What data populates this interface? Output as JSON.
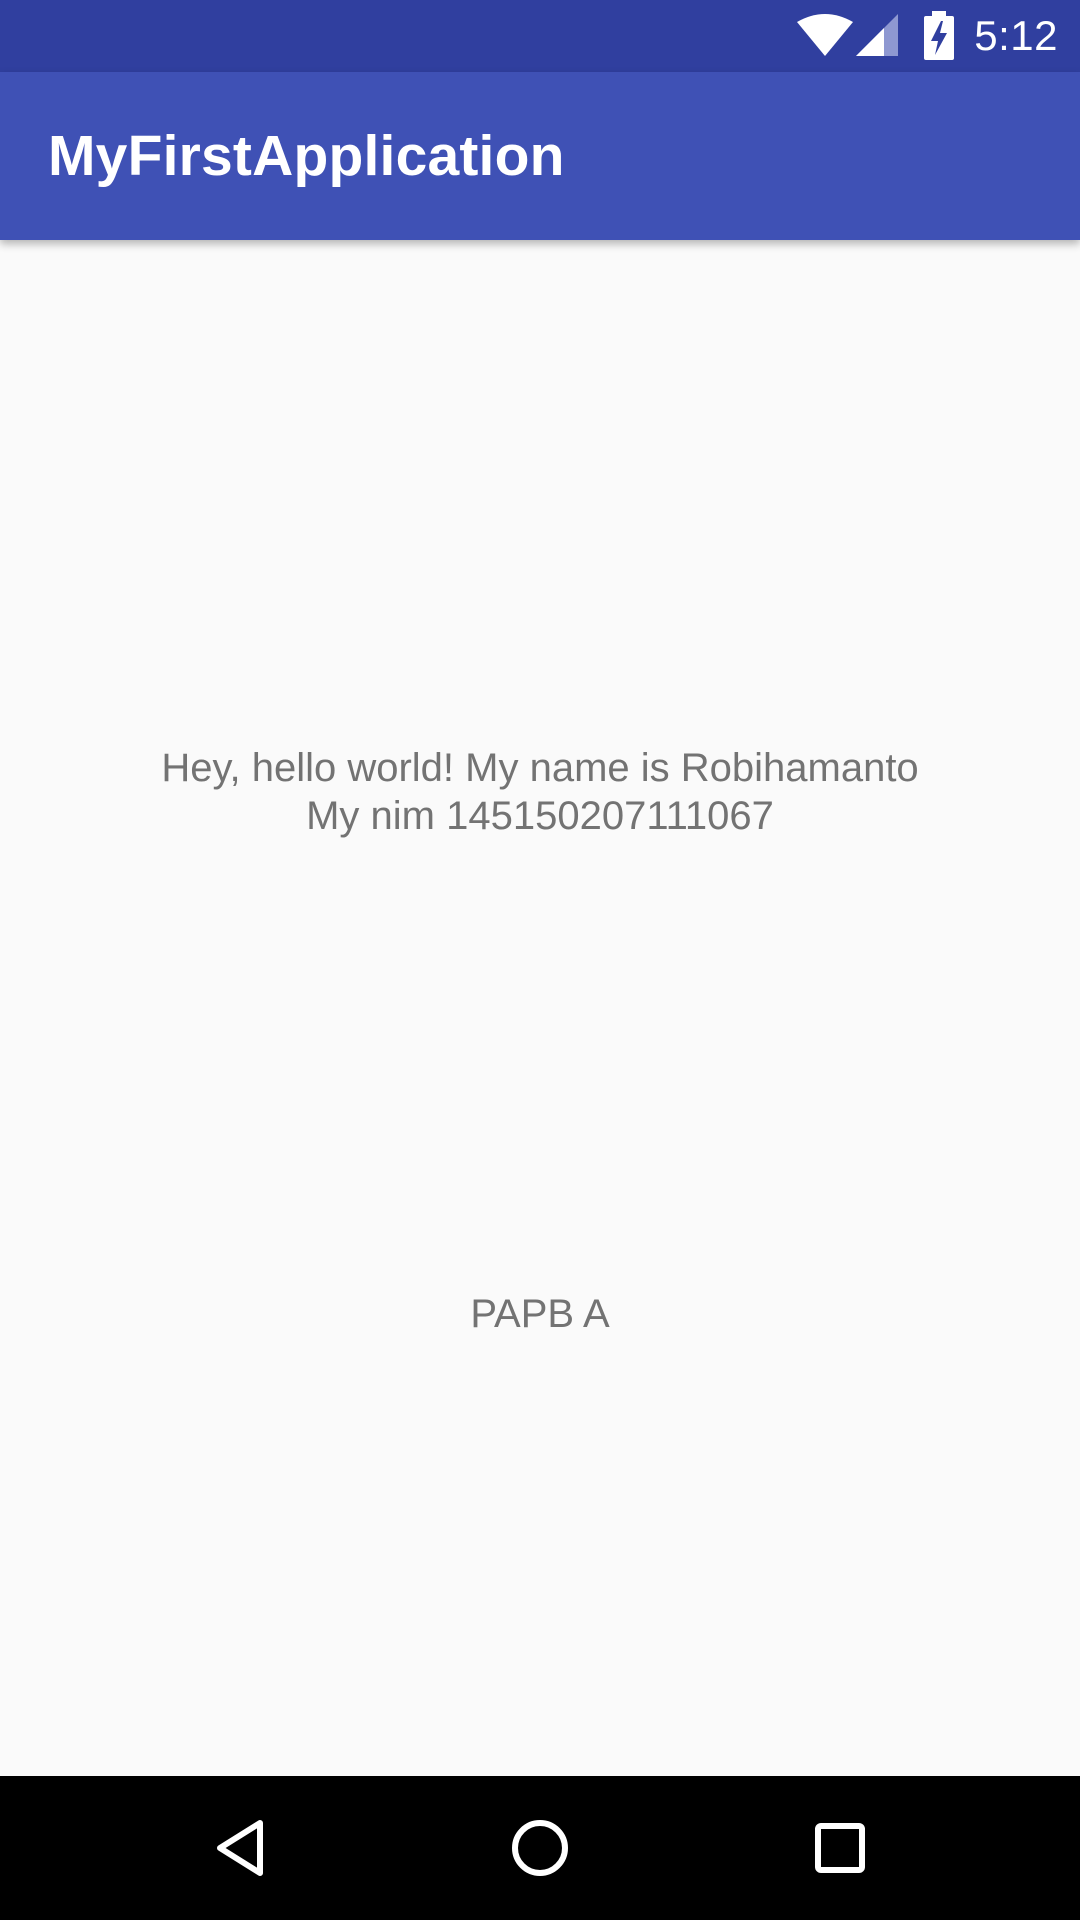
{
  "status_bar": {
    "time": "5:12",
    "icons": [
      "wifi-icon",
      "cellular-signal-icon",
      "battery-charging-icon"
    ],
    "background": "#303f9f"
  },
  "app_bar": {
    "title": "MyFirstApplication",
    "background": "#3f51b5"
  },
  "main": {
    "greeting_line1": "Hey, hello world! My name is Robihamanto",
    "greeting_line2": "My nim 145150207111067",
    "class_label": "PAPB A",
    "text_color": "#737373",
    "background": "#fafafa"
  },
  "nav_bar": {
    "buttons": [
      "back-icon",
      "home-icon",
      "recents-icon"
    ],
    "background": "#000000"
  }
}
